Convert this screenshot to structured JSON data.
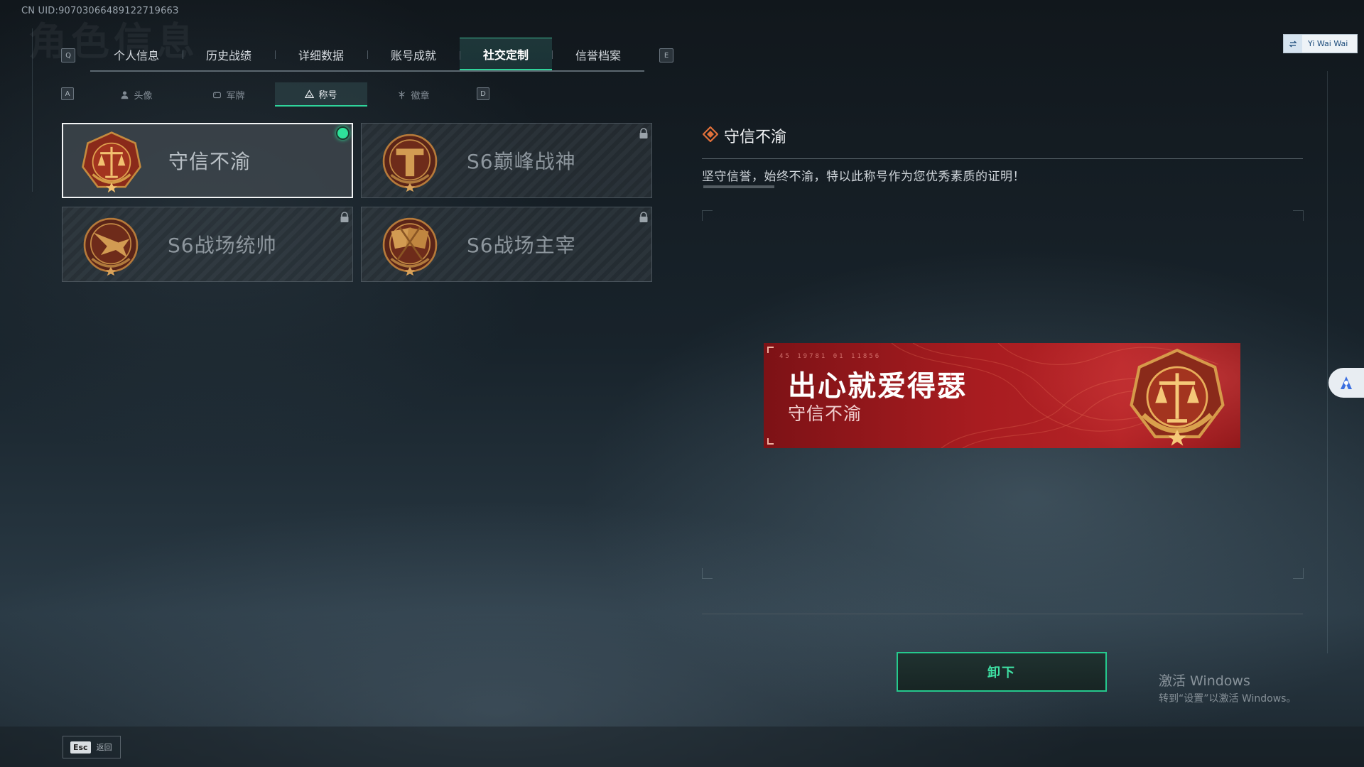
{
  "header": {
    "uid": "CN UID:9070306648912271966З",
    "bg_title": "角色信息"
  },
  "tabs": {
    "prev_key": "Q",
    "next_key": "E",
    "items": [
      {
        "label": "个人信息"
      },
      {
        "label": "历史战绩"
      },
      {
        "label": "详细数据"
      },
      {
        "label": "账号成就"
      },
      {
        "label": "社交定制",
        "active": true
      },
      {
        "label": "信誉档案"
      }
    ]
  },
  "subtabs": {
    "prev_key": "A",
    "next_key": "D",
    "items": [
      {
        "label": "头像",
        "icon": "person-icon"
      },
      {
        "label": "军牌",
        "icon": "dogtag-icon"
      },
      {
        "label": "称号",
        "icon": "title-icon",
        "active": true
      },
      {
        "label": "徽章",
        "icon": "badge-icon"
      }
    ]
  },
  "titles": [
    {
      "name": "守信不渝",
      "emblem": "scales-emblem",
      "equipped": true,
      "locked": false
    },
    {
      "name": "S6巅峰战神",
      "emblem": "t-shield-emblem",
      "equipped": false,
      "locked": true
    },
    {
      "name": "S6战场统帅",
      "emblem": "jet-emblem",
      "equipped": false,
      "locked": true
    },
    {
      "name": "S6战场主宰",
      "emblem": "crossed-flags-emblem",
      "equipped": false,
      "locked": true
    }
  ],
  "detail": {
    "title": "守信不渝",
    "description": "坚守信誉，始终不渝，特以此称号作为您优秀素质的证明！"
  },
  "banner": {
    "player_name": "出心就爱得瑟",
    "title": "守信不渝",
    "code": "45 19781   01 11856"
  },
  "actions": {
    "unequip_label": "卸下"
  },
  "windows_activation": {
    "line1": "激活 Windows",
    "line2": "转到“设置”以激活 Windows。"
  },
  "footer": {
    "esc_key": "Esc",
    "back_label": "返回"
  },
  "user": {
    "name": "Yi Wai Wai"
  },
  "colors": {
    "accent": "#2fd49b",
    "banner_red": "#a81c20",
    "emblem_bronze": "#b8742f"
  }
}
